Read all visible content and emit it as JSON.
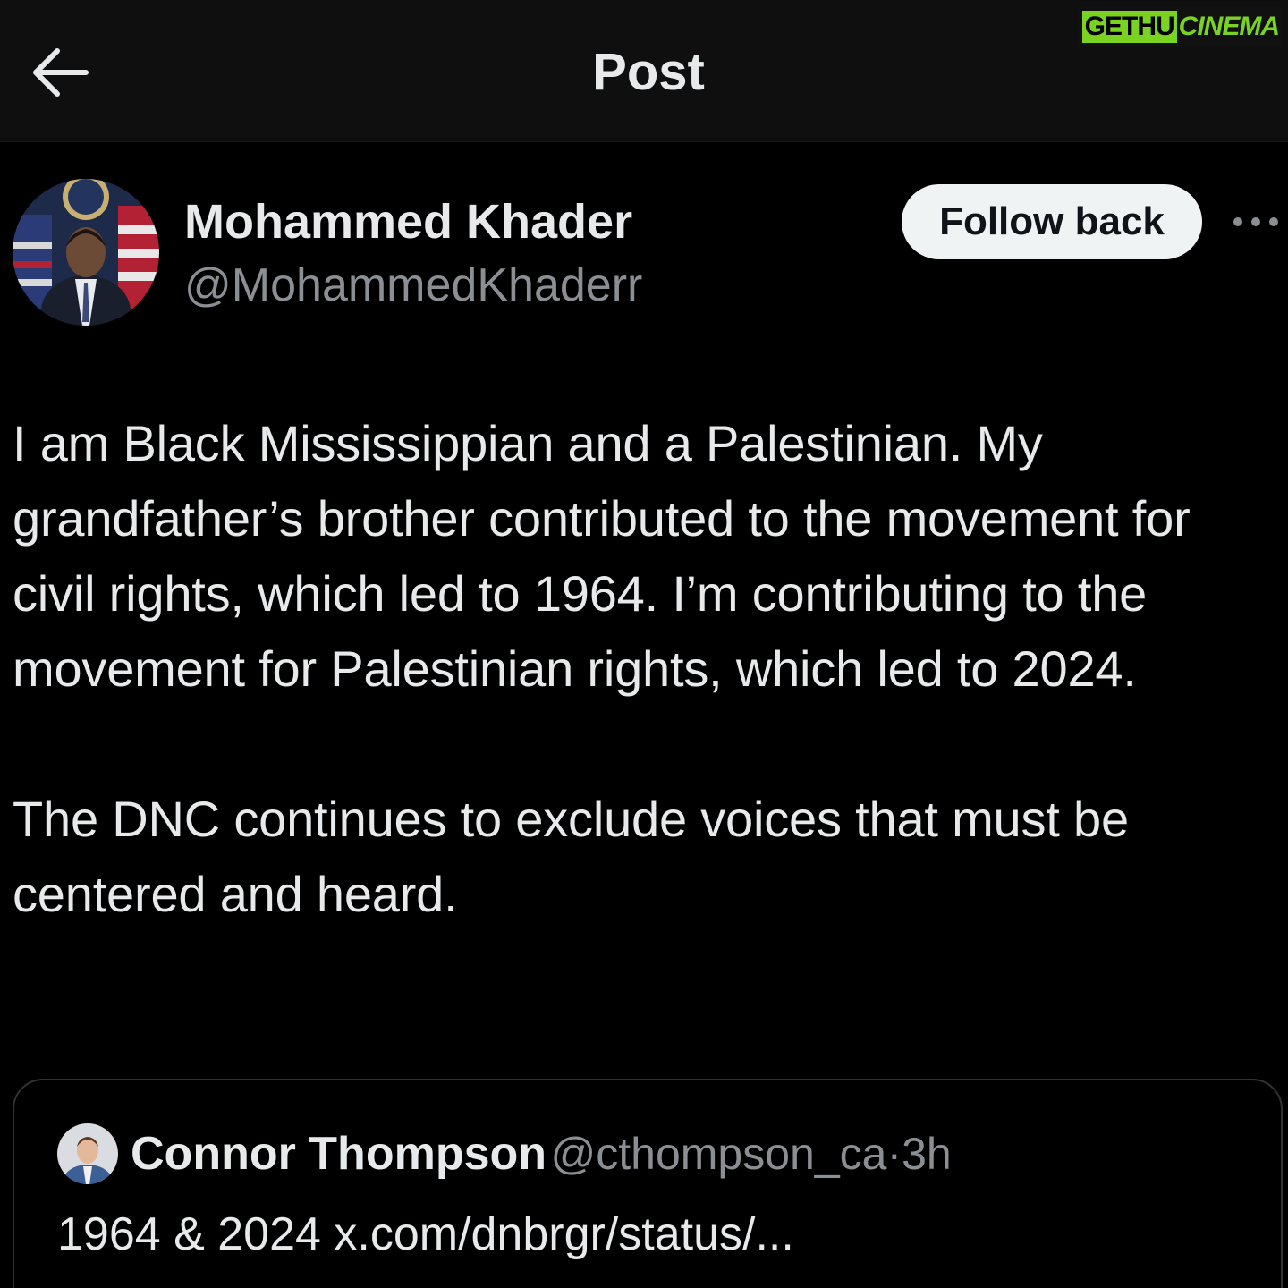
{
  "watermark": {
    "part1": "GETHU",
    "part2": "CINEMA"
  },
  "header": {
    "title": "Post",
    "back_icon": "arrow-left-icon"
  },
  "author": {
    "name": "Mohammed Khader",
    "handle": "@MohammedKhaderr",
    "follow_label": "Follow back",
    "more_icon": "more-horizontal-icon"
  },
  "post": {
    "paragraphs": [
      "I am Black Mississippian and a Palestinian. My grandfather’s brother contributed to the movement for civil rights, which led to 1964. I’m contributing to the movement for Palestinian rights, which led to 2024.",
      "The DNC continues to exclude voices that must be centered and heard."
    ]
  },
  "quote": {
    "name": "Connor Thompson",
    "handle": "@cthompson_ca",
    "separator": "·",
    "time": "3h",
    "text": "1964 & 2024 x.com/dnbrgr/status/..."
  },
  "colors": {
    "background": "#000000",
    "header_bg": "#0f0f0f",
    "text_primary": "#e7e9ea",
    "text_secondary": "#8b8f94",
    "button_bg": "#eff3f4",
    "watermark_green": "#7bd321"
  }
}
